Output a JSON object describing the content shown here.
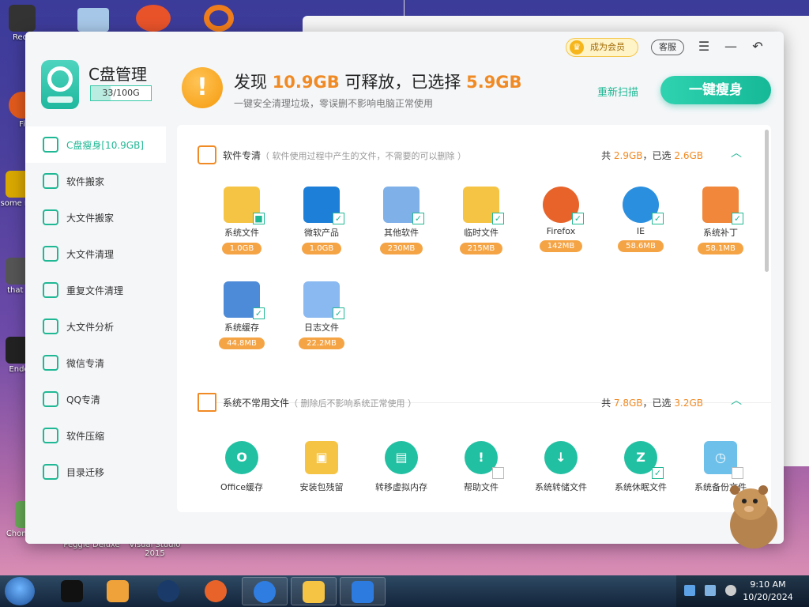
{
  "desktop": {
    "icons": [
      {
        "label": "Recy",
        "color": "#333"
      },
      {
        "label": "Fi",
        "color": "#e25a1c"
      },
      {
        "label": "some ran",
        "color": "#d9a800"
      },
      {
        "label": "that b",
        "color": "#555"
      },
      {
        "label": "Ende",
        "color": "#222"
      },
      {
        "label": "ChomikBox",
        "color": "#6a5"
      }
    ],
    "bottom_labels": [
      "ChomikBox",
      "Peggle Deluxe",
      "Visual Studio 2015"
    ]
  },
  "app": {
    "title": "C盘管理",
    "capacity": "33/100G",
    "capacity_fraction": 0.33,
    "headline_prefix": "发现 ",
    "headline_free": "10.9GB",
    "headline_mid": " 可释放，已选择 ",
    "headline_selected": "5.9GB",
    "subline": "一键安全清理垃圾，零误删不影响电脑正常使用",
    "vip_label": "成为会员",
    "service_label": "客服",
    "rescan_label": "重新扫描",
    "onekey_label": "一键瘦身"
  },
  "nav": [
    {
      "label": "C盘瘦身[10.9GB]",
      "active": true,
      "icon": "broom-icon"
    },
    {
      "label": "软件搬家",
      "active": false,
      "icon": "truck-icon"
    },
    {
      "label": "大文件搬家",
      "active": false,
      "icon": "file-move-icon"
    },
    {
      "label": "大文件清理",
      "active": false,
      "icon": "folder-icon"
    },
    {
      "label": "重复文件清理",
      "active": false,
      "icon": "duplicate-icon"
    },
    {
      "label": "大文件分析",
      "active": false,
      "icon": "chart-icon"
    },
    {
      "label": "微信专清",
      "active": false,
      "icon": "wechat-icon"
    },
    {
      "label": "QQ专清",
      "active": false,
      "icon": "qq-icon"
    },
    {
      "label": "软件压缩",
      "active": false,
      "icon": "compress-icon"
    },
    {
      "label": "目录迁移",
      "active": false,
      "icon": "directory-icon"
    }
  ],
  "section1": {
    "title": "软件专清",
    "desc": "（ 软件使用过程中产生的文件，不需要的可以删除 ）",
    "total_label": "共 ",
    "total": "2.9GB",
    "selected_label": "，已选 ",
    "selected": "2.6GB",
    "items": [
      {
        "name": "系统文件",
        "size": "1.0GB",
        "checked": "partial",
        "color": "#f6c444"
      },
      {
        "name": "微软产品",
        "size": "1.0GB",
        "checked": true,
        "color": "#1e7fd8"
      },
      {
        "name": "其他软件",
        "size": "230MB",
        "checked": true,
        "color": "#7fb0e8"
      },
      {
        "name": "临时文件",
        "size": "215MB",
        "checked": true,
        "color": "#f6c444"
      },
      {
        "name": "Firefox",
        "size": "142MB",
        "checked": true,
        "color": "#e8632a"
      },
      {
        "name": "IE",
        "size": "58.6MB",
        "checked": true,
        "color": "#2b8fe0"
      },
      {
        "name": "系统补丁",
        "size": "58.1MB",
        "checked": true,
        "color": "#f0873a"
      },
      {
        "name": "系统缓存",
        "size": "44.8MB",
        "checked": true,
        "color": "#4d8ad8"
      },
      {
        "name": "日志文件",
        "size": "22.2MB",
        "checked": true,
        "color": "#8ab8f0"
      }
    ]
  },
  "section2": {
    "title": "系统不常用文件",
    "desc": "（ 删除后不影响系统正常使用 ）",
    "total_label": "共 ",
    "total": "7.8GB",
    "selected_label": "，已选 ",
    "selected": "3.2GB",
    "items": [
      {
        "name": "Office缓存",
        "checked": null,
        "glyph": "O"
      },
      {
        "name": "安装包残留",
        "checked": null,
        "glyph": "▣"
      },
      {
        "name": "转移虚拟内存",
        "checked": null,
        "glyph": "▤"
      },
      {
        "name": "帮助文件",
        "checked": false,
        "glyph": "!"
      },
      {
        "name": "系统转储文件",
        "checked": null,
        "glyph": "↓"
      },
      {
        "name": "系统休眠文件",
        "checked": true,
        "glyph": "Z"
      },
      {
        "name": "系统备份文件",
        "checked": false,
        "glyph": "◷"
      }
    ]
  },
  "taskbar": {
    "time": "9:10 AM",
    "date": "10/20/2024"
  }
}
